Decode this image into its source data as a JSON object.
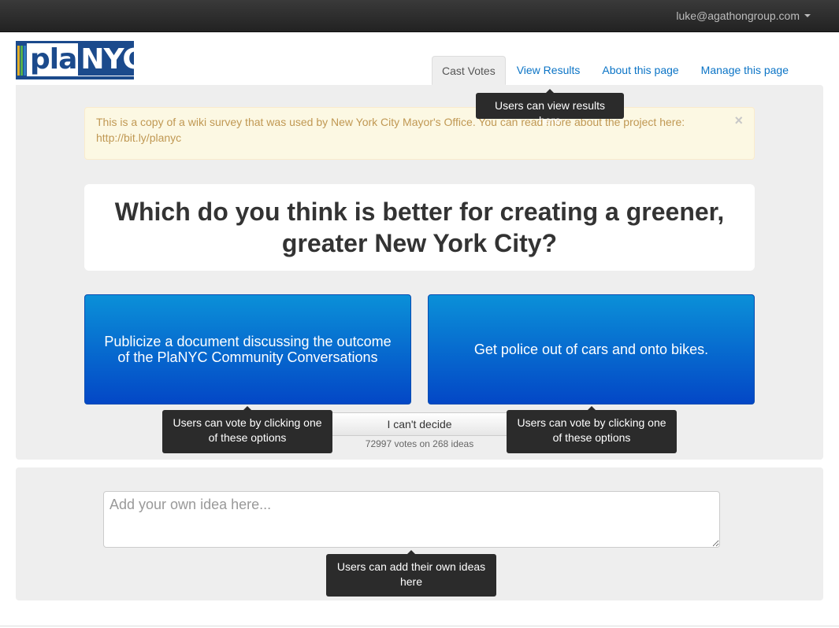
{
  "topbar": {
    "user_email": "luke@agathongroup.com"
  },
  "logo": {
    "text_left": "pla",
    "text_right": "NYC",
    "stripe_colors": [
      "#e3b026",
      "#55b04b",
      "#2f7fc1"
    ]
  },
  "tabs": [
    {
      "label": "Cast Votes",
      "active": true
    },
    {
      "label": "View Results",
      "active": false
    },
    {
      "label": "About this page",
      "active": false
    },
    {
      "label": "Manage this page",
      "active": false
    }
  ],
  "alert": {
    "text": "This is a copy of a wiki survey that was used by New York City Mayor's Office. You can read more about the project here: http://bit.ly/planyc",
    "close_symbol": "×"
  },
  "question": "Which do you think is better for creating a greener, greater New York City?",
  "choices": {
    "left": "Publicize a document discussing the outcome of the PlaNYC Community Conversations",
    "right": "Get police out of cars and onto bikes."
  },
  "cant_decide": "I can't decide",
  "vote_count": "72997 votes on 268 ideas",
  "tooltips": {
    "view_results": "Users can view results here",
    "vote_left": "Users can vote by clicking one of these options",
    "vote_right": "Users can vote by clicking one of these options",
    "add_idea": "Users can add their own ideas here"
  },
  "idea_input": {
    "placeholder": "Add your own idea here...",
    "value": ""
  },
  "colors": {
    "choice_top": "#0b90d8",
    "choice_bottom": "#0347c6",
    "link": "#0b74c6",
    "alert_text": "#c09853"
  }
}
